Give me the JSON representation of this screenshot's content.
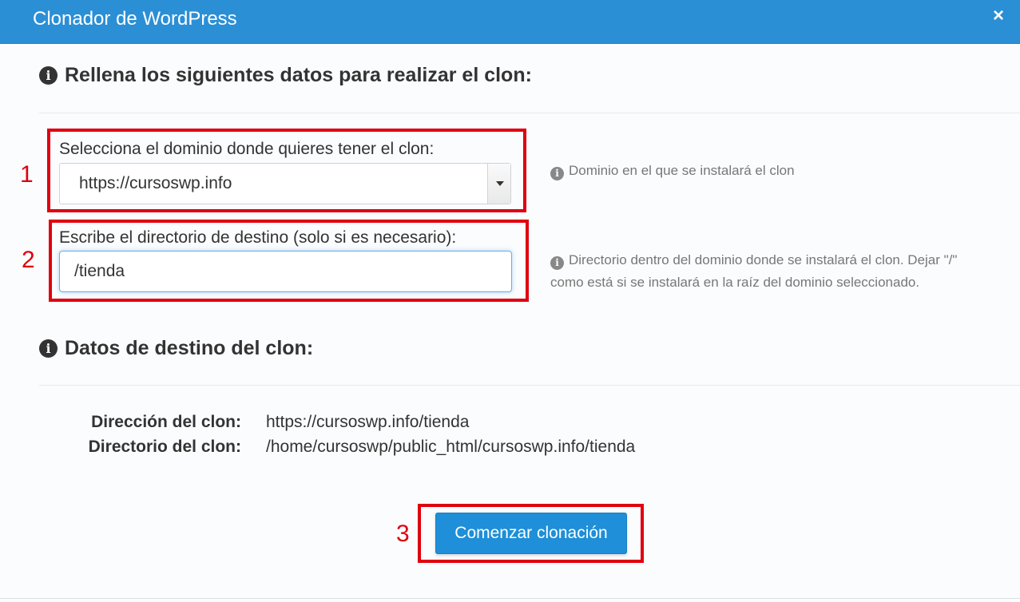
{
  "modal": {
    "title": "Clonador de WordPress",
    "close_label": "×"
  },
  "colors": {
    "header_bg": "#2b8fd6",
    "highlight_red": "#e0000f",
    "button_bg": "#1e8fd8"
  },
  "sections": {
    "form_title": "Rellena los siguientes datos para realizar el clon:",
    "destination_title": "Datos de destino del clon:"
  },
  "domain_field": {
    "step": "1",
    "label": "Selecciona el dominio donde quieres tener el clon:",
    "selected": "https://cursoswp.info",
    "help": "Dominio en el que se instalará el clon"
  },
  "directory_field": {
    "step": "2",
    "label": "Escribe el directorio de destino (solo si es necesario):",
    "value": "/tienda",
    "help_line1": "Directorio dentro del dominio donde se instalará el clon. Dejar \"/\"",
    "help_line2": "como está si se instalará en la raíz del dominio seleccionado."
  },
  "destination": {
    "address_label": "Dirección del clon:",
    "address_value": "https://cursoswp.info/tienda",
    "directory_label": "Directorio del clon:",
    "directory_value": "/home/cursoswp/public_html/cursoswp.info/tienda"
  },
  "action": {
    "step": "3",
    "button_label": "Comenzar clonación"
  }
}
